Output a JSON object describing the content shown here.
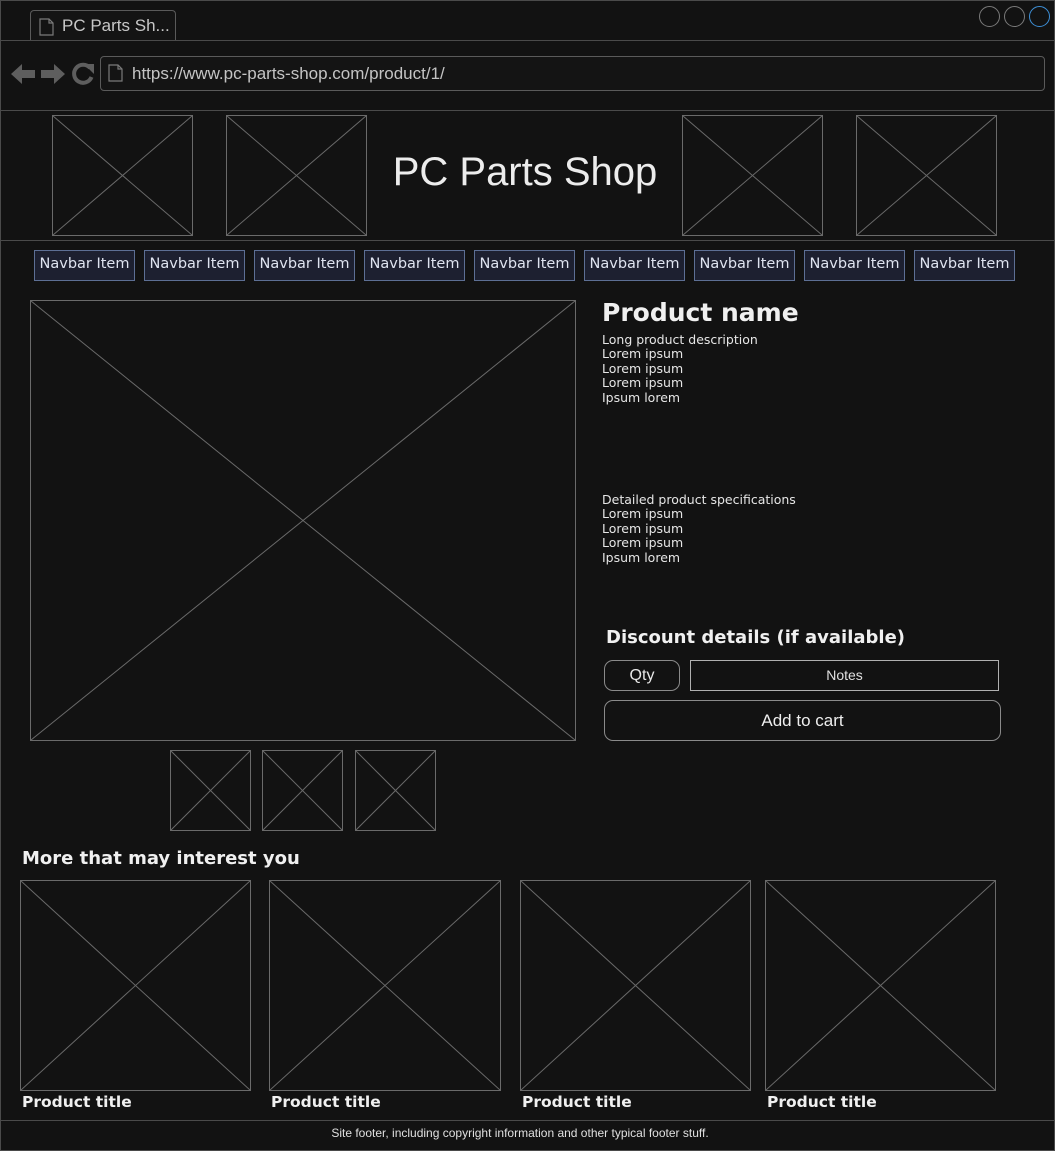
{
  "browser": {
    "tab_title": "PC Parts Sh...",
    "url": "https://www.pc-parts-shop.com/product/1/"
  },
  "header": {
    "site_title": "PC Parts Shop"
  },
  "navbar": {
    "items": [
      "Navbar Item",
      "Navbar Item",
      "Navbar Item",
      "Navbar Item",
      "Navbar Item",
      "Navbar Item",
      "Navbar Item",
      "Navbar Item",
      "Navbar Item"
    ]
  },
  "product": {
    "name": "Product name",
    "description_lines": [
      "Long product description",
      "Lorem ipsum",
      "Lorem ipsum",
      "Lorem ipsum",
      "Ipsum lorem"
    ],
    "spec_lines": [
      "Detailed product specifications",
      "Lorem ipsum",
      "Lorem ipsum",
      "Lorem ipsum",
      "Ipsum lorem"
    ],
    "discount_heading": "Discount details (if available)",
    "qty_label": "Qty",
    "notes_placeholder": "Notes",
    "add_to_cart_label": "Add to cart"
  },
  "recommendations": {
    "heading": "More that may interest you",
    "items": [
      "Product title",
      "Product title",
      "Product title",
      "Product title"
    ]
  },
  "footer": {
    "text": "Site footer, including copyright information and other typical footer stuff."
  },
  "colors": {
    "background": "#121212",
    "navbar_fill": "#1d2030",
    "navbar_border": "#5d6f94",
    "active_window_button": "#3d8fd6"
  }
}
